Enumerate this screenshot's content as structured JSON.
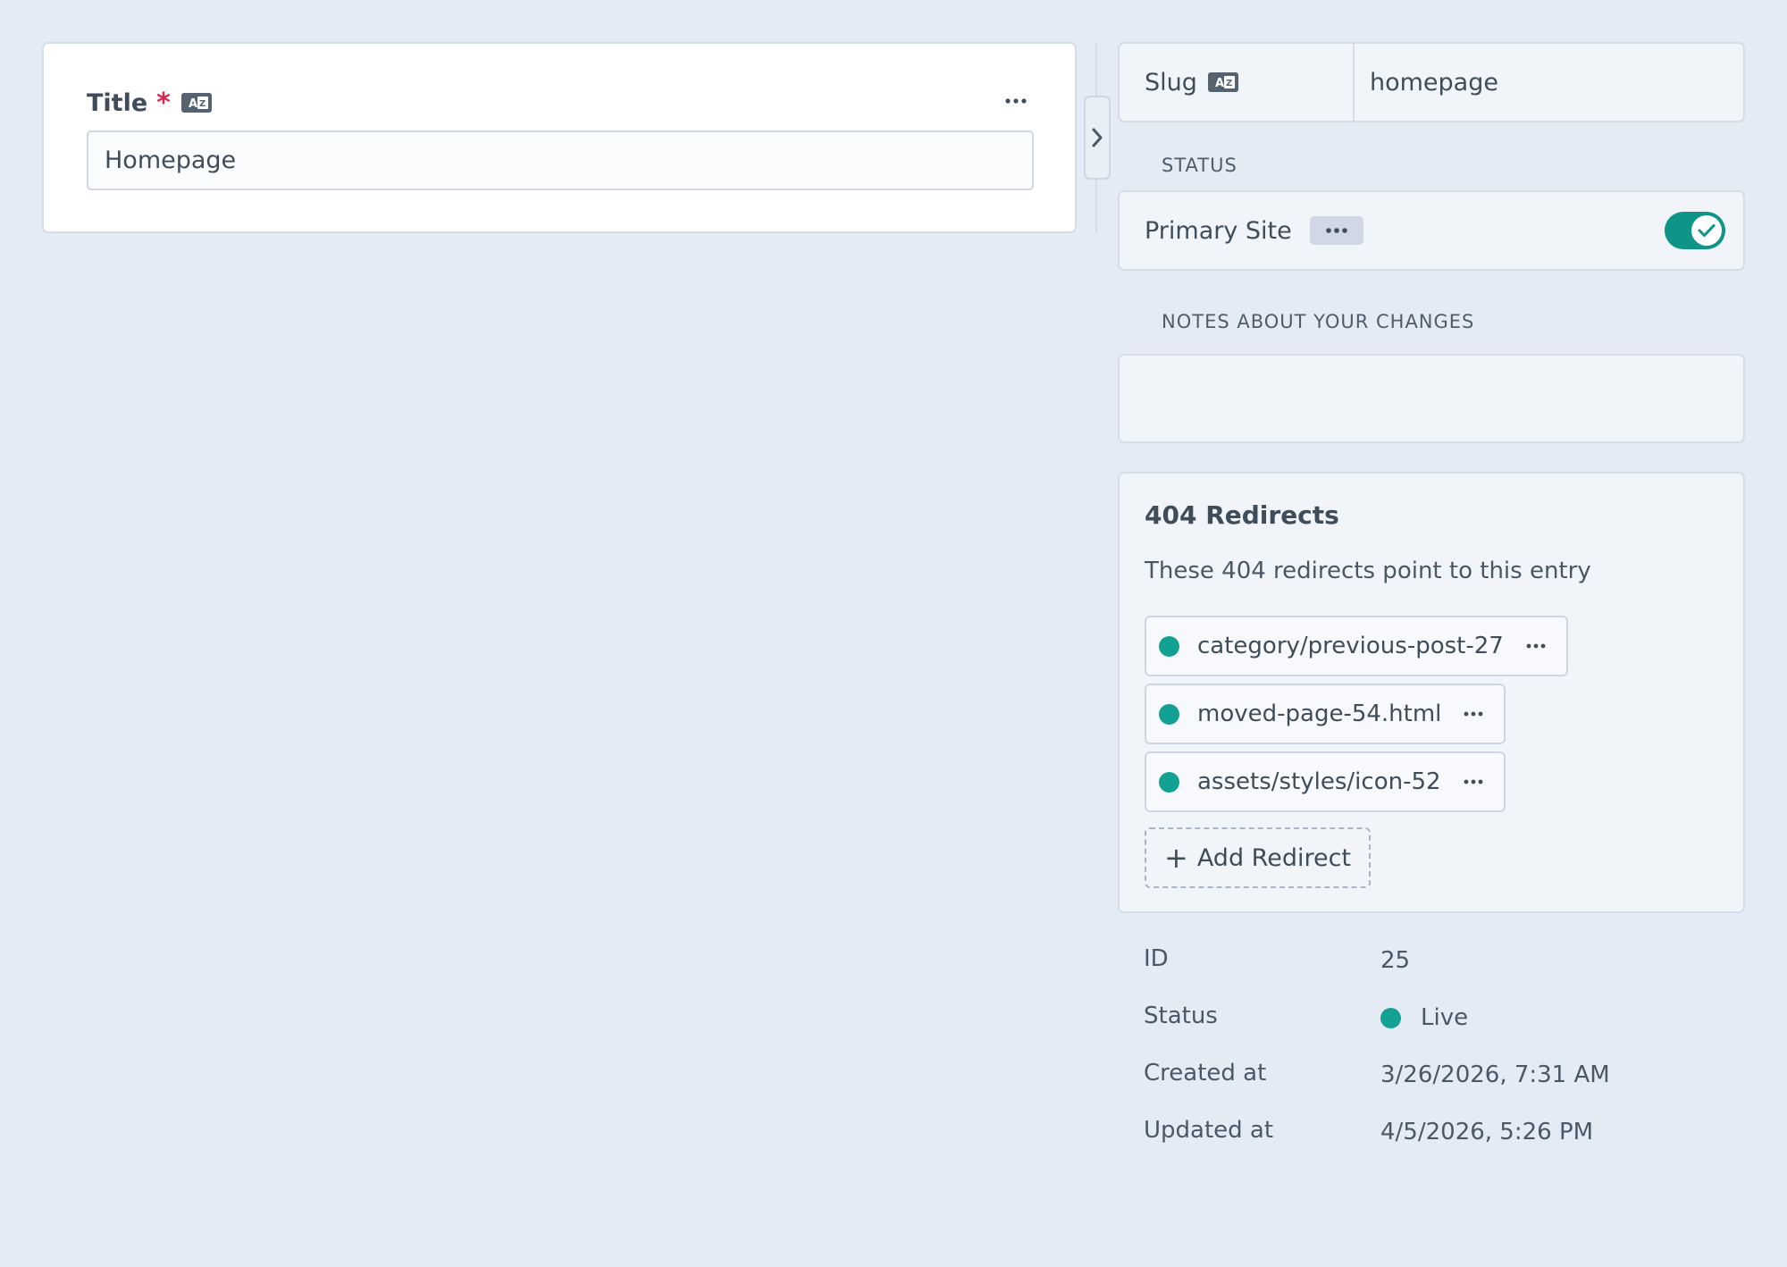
{
  "title_field": {
    "label": "Title",
    "required_mark": "*",
    "value": "Homepage"
  },
  "slug": {
    "label": "Slug",
    "value": "homepage"
  },
  "status_section": {
    "label": "STATUS",
    "site_name": "Primary Site",
    "enabled": true
  },
  "notes_section": {
    "label": "NOTES ABOUT YOUR CHANGES",
    "value": ""
  },
  "redirects": {
    "title": "404 Redirects",
    "description": "These 404 redirects point to this entry",
    "items": [
      {
        "path": "category/previous-post-27"
      },
      {
        "path": "moved-page-54.html"
      },
      {
        "path": "assets/styles/icon-52"
      }
    ],
    "add_label": "Add Redirect"
  },
  "meta": {
    "id_label": "ID",
    "id_value": "25",
    "status_label": "Status",
    "status_value": "Live",
    "created_label": "Created at",
    "created_value": "3/26/2026, 7:31 AM",
    "updated_label": "Updated at",
    "updated_value": "4/5/2026, 5:26 PM"
  },
  "colors": {
    "accent": "#0f9488",
    "required": "#d4284f",
    "background": "#e4ebf5"
  },
  "icons": {
    "translatable": "translatable-icon",
    "more": "ellipsis-icon",
    "collapse": "chevron-right-icon",
    "toggle_check": "check-icon",
    "add": "plus-icon"
  }
}
